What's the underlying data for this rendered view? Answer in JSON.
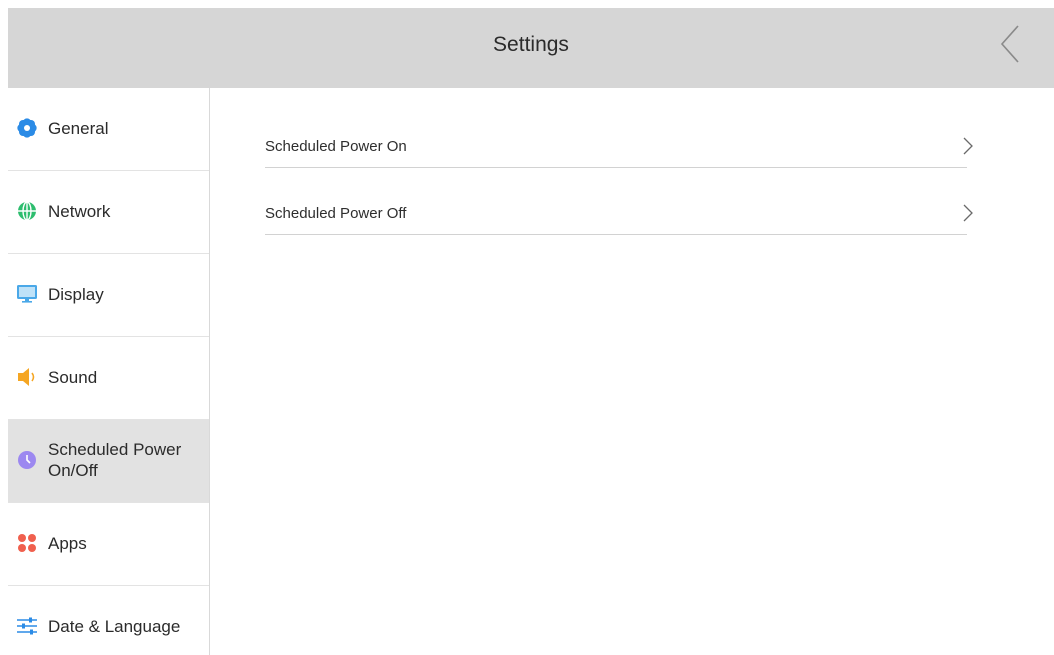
{
  "header": {
    "title": "Settings",
    "back_icon": "chevron-left-icon"
  },
  "sidebar": {
    "items": [
      {
        "label": "General",
        "icon": "gear-icon",
        "icon_color": "#2b8be6",
        "active": false
      },
      {
        "label": "Network",
        "icon": "globe-icon",
        "icon_color": "#2dbd6e",
        "active": false
      },
      {
        "label": "Display",
        "icon": "monitor-icon",
        "icon_color": "#4aa8e8",
        "active": false
      },
      {
        "label": "Sound",
        "icon": "speaker-icon",
        "icon_color": "#f5a623",
        "active": false
      },
      {
        "label": "Scheduled Power On/Off",
        "icon": "clock-icon",
        "icon_color": "#9c88f0",
        "active": true
      },
      {
        "label": "Apps",
        "icon": "apps-icon",
        "icon_color": "#f0604e",
        "active": false
      },
      {
        "label": "Date & Language",
        "icon": "sliders-icon",
        "icon_color": "#2b8be6",
        "active": false
      }
    ]
  },
  "main": {
    "rows": [
      {
        "label": "Scheduled Power On",
        "icon": "chevron-right-icon"
      },
      {
        "label": "Scheduled Power Off",
        "icon": "chevron-right-icon"
      }
    ]
  }
}
